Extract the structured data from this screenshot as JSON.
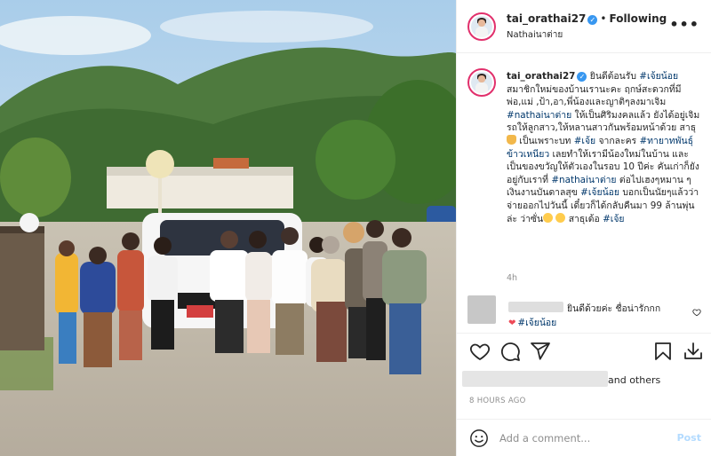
{
  "post": {
    "photo_alt": "Group photo"
  },
  "header": {
    "username": "tai_orathai27",
    "verified_mark": "✓",
    "separator": "•",
    "follow_state": "Following",
    "location": "Nathaiนาต่าย",
    "more": "•••"
  },
  "caption": {
    "username": "tai_orathai27",
    "verified_mark": "✓",
    "seg1": " ยินดีต้อนรับ ",
    "tag1": "#เจ้ยน้อย",
    "seg2": " สมาชิกใหม่ของบ้านเรานะคะ ฤกษ์สะดวกที่มี พ่อ,แม่ ,ป้า,อา,พี่น้องและญาติๆลงมาเจิม ",
    "tag2": "#nathaiนาต่าย",
    "seg3": " ให้เป็นศิริมงคลแล้ว ยังได้อยู่เจิมรถให้ลูกสาว,ให้หลานสาวกันพร้อมหน้าด้วย สาธุ",
    "seg4": " เป็นเพราะบท ",
    "tag3": "#เจ้ย",
    "seg5": " จากละคร ",
    "tag4": "#ทายาทพันธุ์ข้าวเหนียว",
    "seg6": " เลยทำให้เรามีน้องใหม่ในบ้าน และเป็นของขวัญให้ตัวเองในรอบ 10 ปีค่ะ คันเก่าก็ยังอยู่กับเราที่ ",
    "tag5": "#nathaiนาต่าย",
    "seg7": " ต่อไปเฮงๆหมาน ๆเงินงานบันดาลสุข ",
    "tag6": "#เจ้ยน้อย",
    "seg8": " บอกเป็นนัยๆแล้วว่าจ่ายออกไปวันนี้ เดี๋ยวก็ได้กลับคืนมา 99 ล้านพุ่นล่ะ ว่าซั่น",
    "seg9": " สาธุเด้อ ",
    "tag7": "#เจ้ย",
    "time_ago": "4h"
  },
  "comment2": {
    "text": "ยินดีด้วยค่ะ ชื่อน่ารักกก",
    "heart": "❤",
    "tag": "#เจ้ยน้อย"
  },
  "likes": {
    "suffix": "and others"
  },
  "posted": "8 HOURS AGO",
  "add_comment": {
    "placeholder": "Add a comment...",
    "post_label": "Post"
  },
  "icons": [
    "heart-icon",
    "comment-icon",
    "share-icon",
    "bookmark-icon",
    "download-icon",
    "emoji-icon",
    "more-icon"
  ],
  "colors": {
    "link": "#00376b",
    "verified": "#3897f0",
    "ring": "#e1306c",
    "post_disabled": "#b3dbff",
    "muted": "#8e8e8e"
  }
}
